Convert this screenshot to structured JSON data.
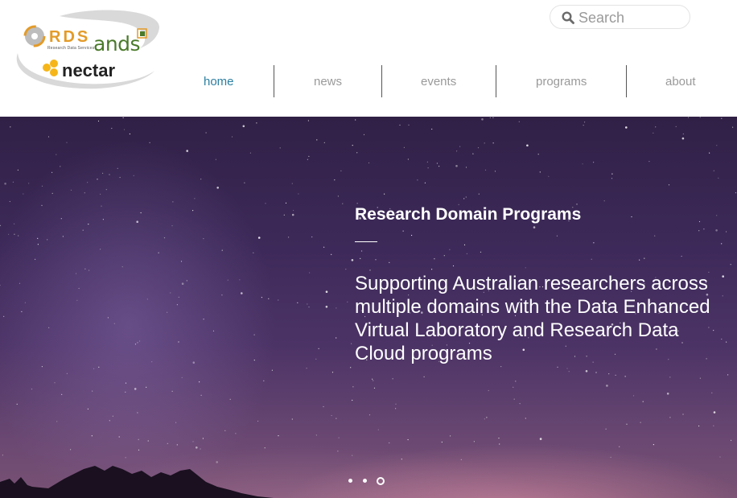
{
  "logo": {
    "rds": "RDS",
    "rds_subtitle": "Research Data Services",
    "ands": "ands",
    "nectar": "nectar"
  },
  "search": {
    "placeholder": "Search"
  },
  "nav": {
    "items": [
      {
        "label": "home",
        "active": true
      },
      {
        "label": "news",
        "active": false
      },
      {
        "label": "events",
        "active": false
      },
      {
        "label": "programs",
        "active": false
      },
      {
        "label": "about",
        "active": false
      }
    ]
  },
  "hero": {
    "title": "Research Domain Programs",
    "description": "Supporting Australian researchers across multiple domains with the Data Enhanced Virtual Laboratory and Research Data Cloud programs",
    "slides": {
      "count": 3,
      "active_index": 3
    }
  },
  "colors": {
    "nav_active": "#2c7fa1",
    "nav_inactive": "#9a9a9a",
    "rds_orange": "#e39b28",
    "ands_green": "#4a7a2a",
    "nectar_yellow": "#f6b619"
  }
}
